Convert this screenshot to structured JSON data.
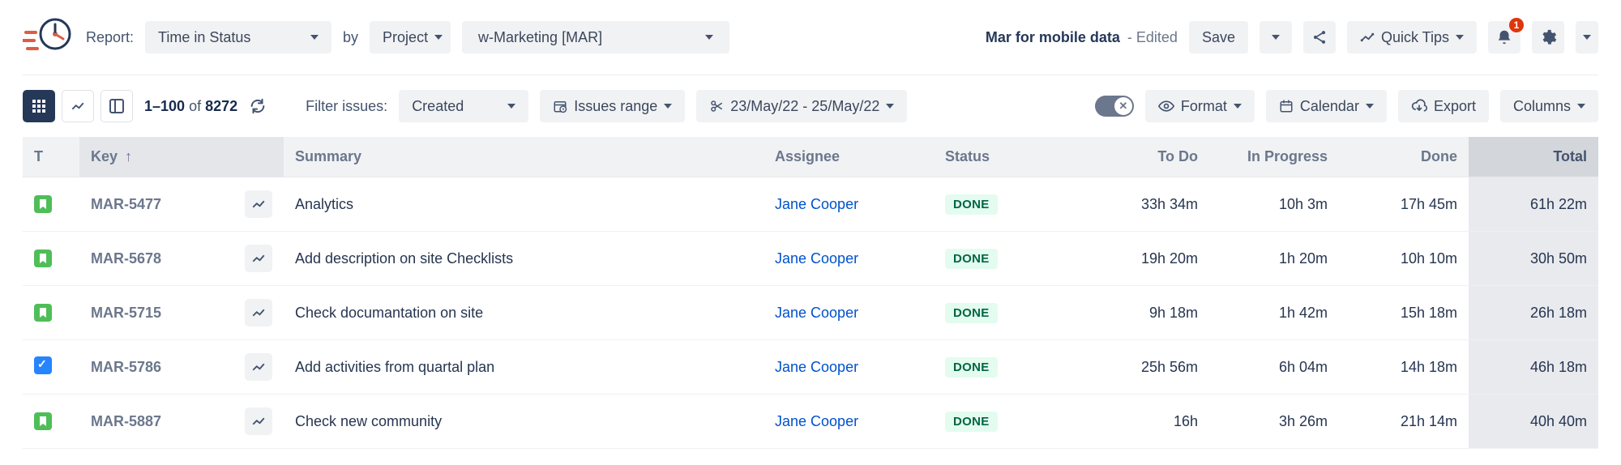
{
  "header": {
    "report_label": "Report:",
    "report_value": "Time in Status",
    "by_label": "by",
    "by_value": "Project",
    "project_value": "w-Marketing [MAR]",
    "saved_name": "Mar for mobile data",
    "saved_suffix": " - Edited",
    "save_label": "Save",
    "quicktips_label": "Quick Tips",
    "bell_count": "1"
  },
  "toolbar": {
    "pagination_range": "1–100",
    "pagination_of": "of",
    "pagination_total": "8272",
    "filter_label": "Filter issues:",
    "filter_value": "Created",
    "issues_range_label": "Issues range",
    "date_range": "23/May/22 - 25/May/22",
    "format_label": "Format",
    "calendar_label": "Calendar",
    "export_label": "Export",
    "columns_label": "Columns"
  },
  "columns": {
    "t": "T",
    "key": "Key",
    "summary": "Summary",
    "assignee": "Assignee",
    "status": "Status",
    "todo": "To Do",
    "in_progress": "In Progress",
    "done": "Done",
    "total": "Total"
  },
  "rows": [
    {
      "type": "story",
      "key": "MAR-5477",
      "summary": "Analytics",
      "assignee": "Jane Cooper",
      "status": "DONE",
      "todo": "33h 34m",
      "in_progress": "10h 3m",
      "done": "17h 45m",
      "total": "61h 22m"
    },
    {
      "type": "story",
      "key": "MAR-5678",
      "summary": "Add description on site Checklists",
      "assignee": "Jane Cooper",
      "status": "DONE",
      "todo": "19h 20m",
      "in_progress": "1h 20m",
      "done": "10h 10m",
      "total": "30h 50m"
    },
    {
      "type": "story",
      "key": "MAR-5715",
      "summary": "Check documantation on site",
      "assignee": "Jane Cooper",
      "status": "DONE",
      "todo": "9h 18m",
      "in_progress": "1h 42m",
      "done": "15h 18m",
      "total": "26h 18m"
    },
    {
      "type": "task",
      "key": "MAR-5786",
      "summary": "Add activities from quartal plan",
      "assignee": "Jane Cooper",
      "status": "DONE",
      "todo": "25h 56m",
      "in_progress": "6h 04m",
      "done": "14h 18m",
      "total": "46h 18m"
    },
    {
      "type": "story",
      "key": "MAR-5887",
      "summary": "Check new community",
      "assignee": "Jane Cooper",
      "status": "DONE",
      "todo": "16h",
      "in_progress": "3h 26m",
      "done": "21h 14m",
      "total": "40h 40m"
    }
  ]
}
